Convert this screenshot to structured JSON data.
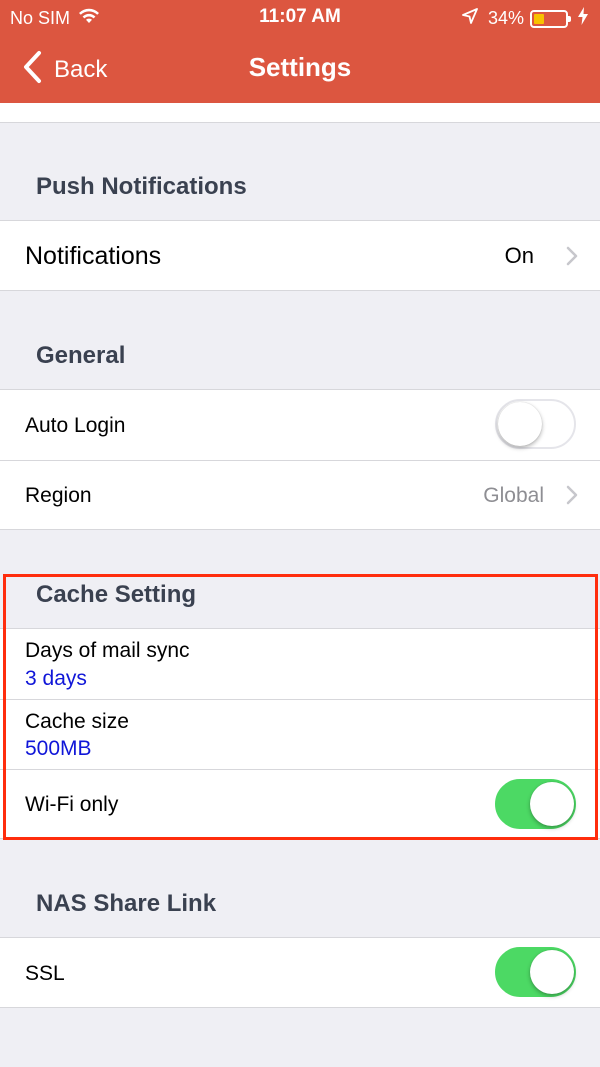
{
  "status_bar": {
    "carrier": "No SIM",
    "time": "11:07 AM",
    "battery_percent": "34%",
    "battery_level": 0.34,
    "icons": [
      "wifi-icon",
      "location-arrow-icon",
      "battery-icon",
      "charging-bolt-icon"
    ]
  },
  "nav": {
    "back_label": "Back",
    "title": "Settings"
  },
  "sections": {
    "push": {
      "header": "Push Notifications",
      "notifications": {
        "label": "Notifications",
        "value": "On"
      }
    },
    "general": {
      "header": "General",
      "auto_login": {
        "label": "Auto Login",
        "on": false
      },
      "region": {
        "label": "Region",
        "value": "Global"
      }
    },
    "cache": {
      "header": "Cache Setting",
      "days_sync": {
        "label": "Days of mail sync",
        "value": "3 days"
      },
      "cache_size": {
        "label": "Cache size",
        "value": "500MB"
      },
      "wifi_only": {
        "label": "Wi-Fi only",
        "on": true
      }
    },
    "nas": {
      "header": "NAS Share Link",
      "ssl": {
        "label": "SSL",
        "on": true
      }
    }
  },
  "colors": {
    "header_bg": "#dc5640",
    "toggle_on": "#4cd964",
    "link_blue": "#1016d8",
    "highlight": "#ff2d0d"
  }
}
